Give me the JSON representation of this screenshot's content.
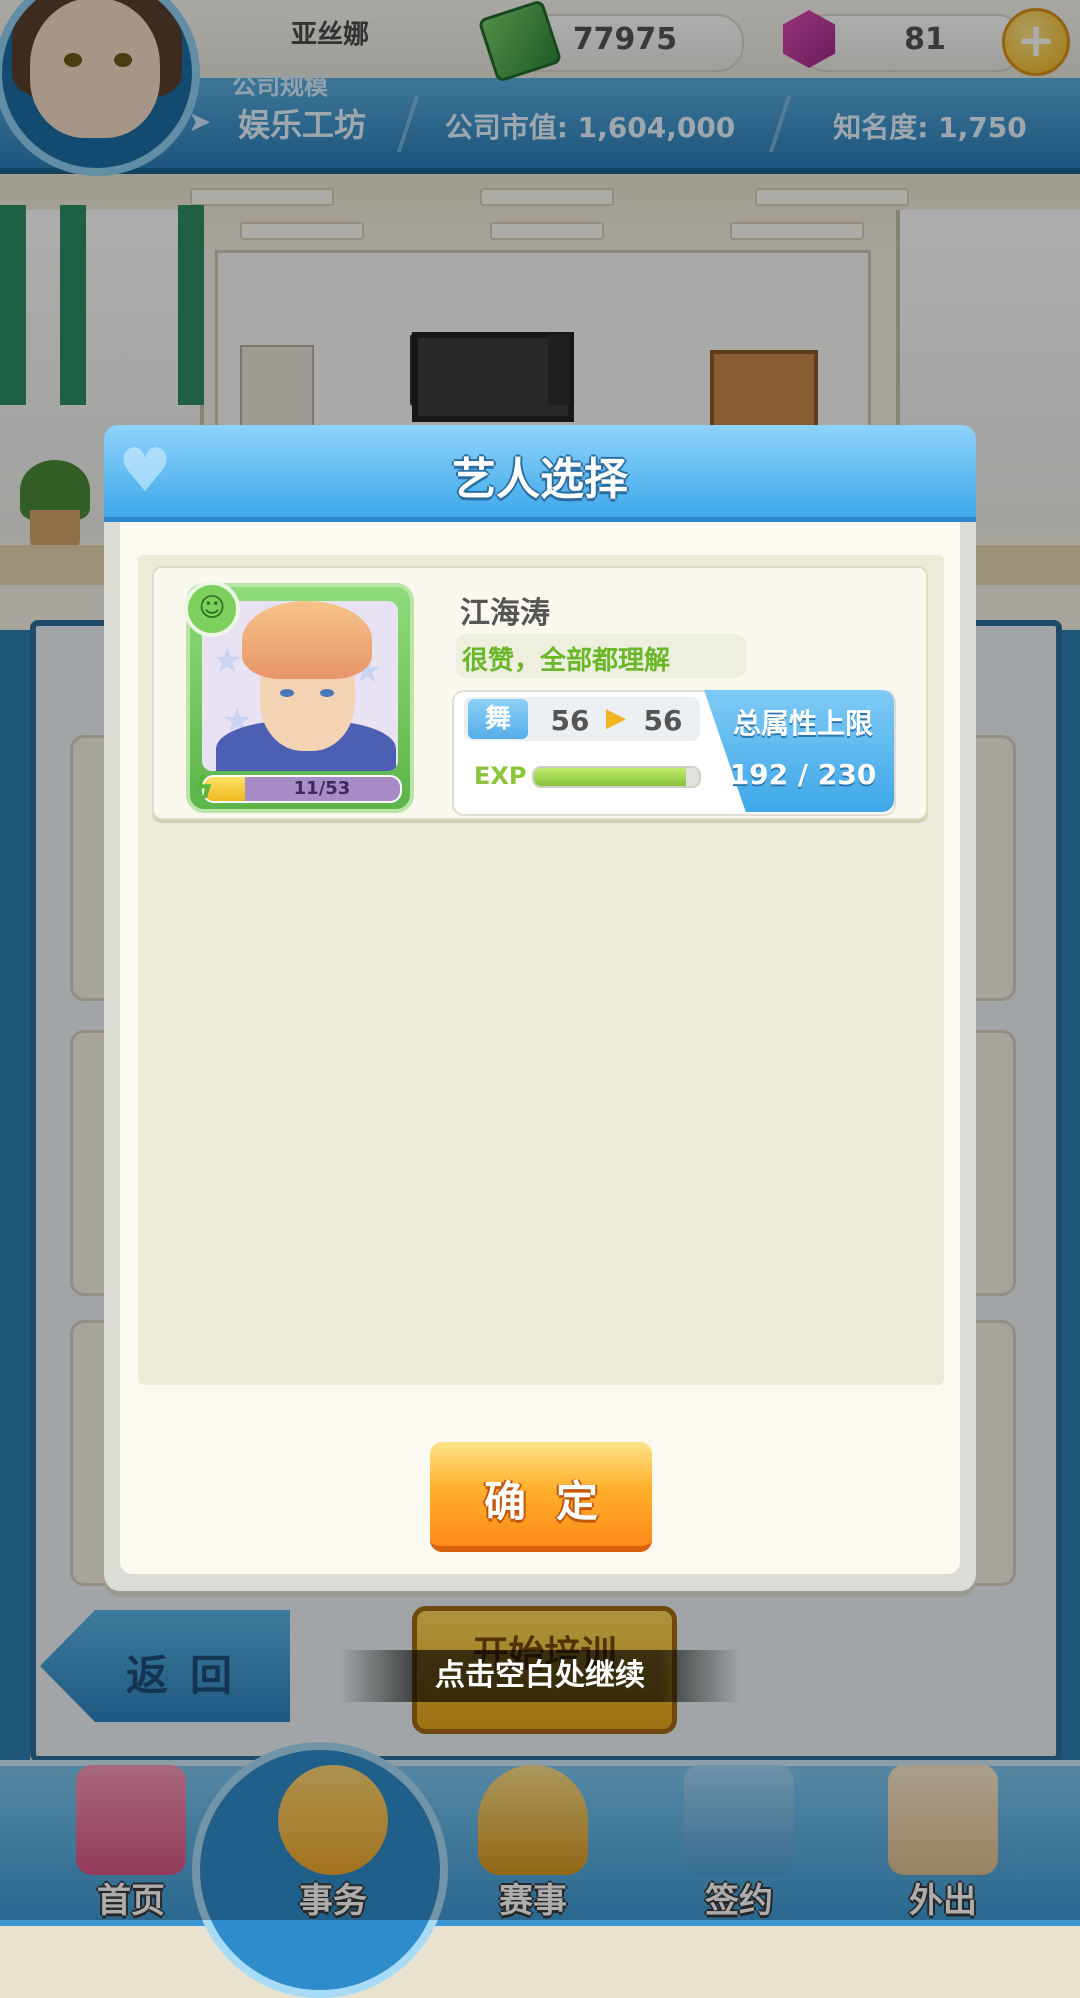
{
  "hud": {
    "player_name": "亚丝娜",
    "money": "77975",
    "gems": "81",
    "plus_symbol": "+",
    "company_scale_label": "公司规模",
    "company_scale_value": "娱乐工坊",
    "market_value": "公司市值: 1,604,000",
    "fame": "知名度: 1,750"
  },
  "dialog": {
    "title": "艺人选择",
    "confirm_label": "确定"
  },
  "artist": {
    "name": "江海涛",
    "comment": "很赞，全部都理解",
    "energy_text": "11/53",
    "energy_fraction": 0.2075,
    "stat_name": "舞",
    "stat_from": "56",
    "stat_to": "56",
    "exp_label": "EXP",
    "exp_fraction": 0.92,
    "limit_label": "总属性上限",
    "limit_value": "192 / 230"
  },
  "background_buttons": {
    "back_label": "返回",
    "start_label": "开始培训"
  },
  "hint": "点击空白处继续",
  "nav": [
    {
      "label": "首页",
      "icon": "home-icon",
      "color": "#e86f9a"
    },
    {
      "label": "事务",
      "icon": "manager-icon",
      "color": "#f6c552"
    },
    {
      "label": "赛事",
      "icon": "trophy-icon",
      "color": "#e9b63a"
    },
    {
      "label": "签约",
      "icon": "contract-icon",
      "color": "#6bb6e6"
    },
    {
      "label": "外出",
      "icon": "door-exit-icon",
      "color": "#f2d9b0"
    }
  ],
  "colors": {
    "accent_blue": "#3fa8ea",
    "confirm_orange": "#ffb02c",
    "comment_green": "#6ab72a"
  }
}
